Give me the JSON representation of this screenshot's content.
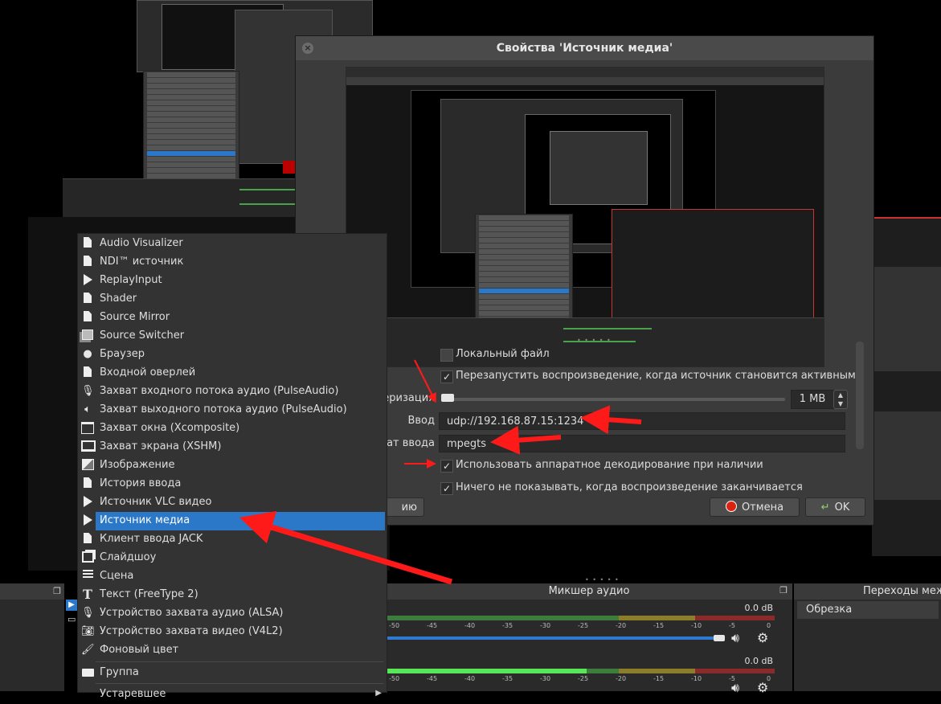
{
  "dialog": {
    "title": "Свойства 'Источник медиа'",
    "close_icon": "close-icon"
  },
  "properties": {
    "local_file_label": "Локальный файл",
    "local_file_checked": false,
    "restart_label": "Перезапустить воспроизведение, когда источник становится активным",
    "restart_checked": true,
    "buffering_label": "феризация",
    "buffering_value": "1 MB",
    "buffering_fraction": 0.01,
    "input_label": "Ввод",
    "input_value": "udp://192.168.87.15:1234",
    "input_format_label": "мат ввода",
    "input_format_value": "mpegts",
    "hw_decode_label": "Использовать аппаратное декодирование при наличии",
    "hw_decode_checked": true,
    "hide_on_end_label": "Ничего не показывать, когда воспроизведение заканчивается",
    "hide_on_end_checked": true,
    "check_mark": "✓"
  },
  "buttons": {
    "defaults_partial": "ию",
    "cancel": "Отмена",
    "ok": "OK"
  },
  "menu": {
    "items": [
      {
        "label": "Audio Visualizer",
        "icon": "document-icon"
      },
      {
        "label": "NDI™ источник",
        "icon": "document-icon"
      },
      {
        "label": "ReplayInput",
        "icon": "play-icon"
      },
      {
        "label": "Shader",
        "icon": "document-icon"
      },
      {
        "label": "Source Mirror",
        "icon": "document-icon"
      },
      {
        "label": "Source Switcher",
        "icon": "switch-icon"
      },
      {
        "label": "Браузер",
        "icon": "globe-icon"
      },
      {
        "label": "Входной оверлей",
        "icon": "document-icon"
      },
      {
        "label": "Захват входного потока аудио (PulseAudio)",
        "icon": "microphone-icon"
      },
      {
        "label": "Захват выходного потока аудио (PulseAudio)",
        "icon": "speaker-icon"
      },
      {
        "label": "Захват окна (Xcomposite)",
        "icon": "window-icon"
      },
      {
        "label": "Захват экрана (XSHM)",
        "icon": "monitor-icon"
      },
      {
        "label": "Изображение",
        "icon": "image-icon"
      },
      {
        "label": "История ввода",
        "icon": "document-icon"
      },
      {
        "label": "Источник VLC видео",
        "icon": "play-icon"
      },
      {
        "label": "Источник медиа",
        "icon": "play-icon",
        "selected": true
      },
      {
        "label": "Клиент ввода JACK",
        "icon": "document-icon"
      },
      {
        "label": "Слайдшоу",
        "icon": "slideshow-icon"
      },
      {
        "label": "Сцена",
        "icon": "list-icon"
      },
      {
        "label": "Текст (FreeType 2)",
        "icon": "text-icon"
      },
      {
        "label": "Устройство захвата аудио (ALSA)",
        "icon": "microphone-icon"
      },
      {
        "label": "Устройство захвата видео (V4L2)",
        "icon": "camera-icon"
      },
      {
        "label": "Фоновый цвет",
        "icon": "brush-icon"
      }
    ],
    "group_label": "Группа",
    "deprecated_label": "Устаревшее"
  },
  "mixer": {
    "title": "Микшер аудио",
    "track1_db": "0.0 dB",
    "track2_db": "0.0 dB",
    "ticks": [
      "-50",
      "-45",
      "-40",
      "-35",
      "-30",
      "-25",
      "-20",
      "-15",
      "-10",
      "-5",
      "0"
    ]
  },
  "transitions": {
    "title": "Переходы меж",
    "selected": "Обрезка"
  },
  "colors": {
    "accent": "#2b78c9",
    "annotation_arrow": "#ff1a1a"
  }
}
